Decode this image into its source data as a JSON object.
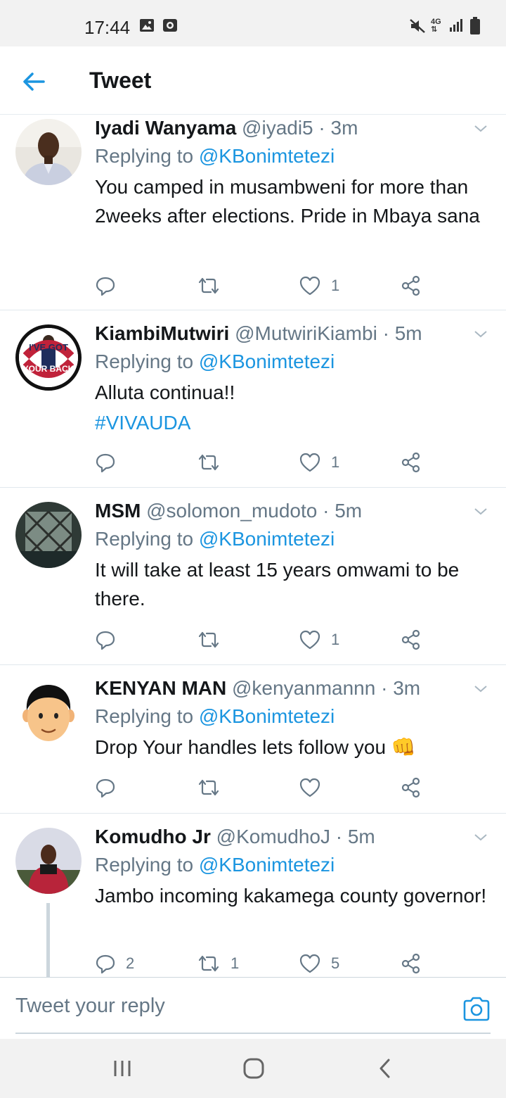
{
  "status_bar": {
    "time": "17:44",
    "network": "4G",
    "icons": [
      "image-icon",
      "app-icon",
      "mute-icon",
      "signal-icon",
      "battery-icon"
    ]
  },
  "header": {
    "title": "Tweet",
    "back_icon": "arrow-left-icon"
  },
  "colors": {
    "accent": "#1b95e0",
    "text": "#14171a",
    "secondary": "#657786",
    "divider": "#e1e8ed"
  },
  "tweets": [
    {
      "name": "Iyadi Wanyama",
      "handle": "@iyadi5",
      "time": "3m",
      "replying_prefix": "Replying to",
      "replying_to": "@KBonimtetezi",
      "text": "You camped in musambweni  for more than 2weeks  after elections. Pride in Mbaya sana",
      "hashtag": "",
      "replies": "",
      "retweets": "",
      "likes": "1"
    },
    {
      "name": "KiambiMutwiri",
      "handle": "@MutwiriKiambi",
      "time": "5m",
      "replying_prefix": "Replying to",
      "replying_to": "@KBonimtetezi",
      "text": "Alluta continua!!",
      "hashtag": "#VIVAUDA",
      "avatar_text_top": "I'VE GOT",
      "avatar_text_bottom": "YOUR BACK",
      "replies": "",
      "retweets": "",
      "likes": "1"
    },
    {
      "name": "MSM",
      "handle": "@solomon_mudoto",
      "time": "5m",
      "replying_prefix": "Replying to",
      "replying_to": "@KBonimtetezi",
      "text": "It will take at least 15 years omwami to be there.",
      "hashtag": "",
      "replies": "",
      "retweets": "",
      "likes": "1"
    },
    {
      "name": "KENYAN MAN",
      "handle": "@kenyanmannn",
      "time": "3m",
      "replying_prefix": "Replying to",
      "replying_to": "@KBonimtetezi",
      "text": "Drop Your handles lets follow you 👊",
      "hashtag": "",
      "replies": "",
      "retweets": "",
      "likes": ""
    },
    {
      "name": "Komudho Jr",
      "handle": "@KomudhoJ",
      "time": "5m",
      "replying_prefix": "Replying to",
      "replying_to": "@KBonimtetezi",
      "text": "Jambo incoming kakamega county governor!",
      "hashtag": "",
      "replies": "2",
      "retweets": "1",
      "likes": "5"
    }
  ],
  "reply_bar": {
    "placeholder": "Tweet your reply",
    "camera_icon": "camera-icon"
  },
  "nav_bar": {
    "icons": [
      "recent-apps-icon",
      "home-icon",
      "back-icon"
    ]
  }
}
